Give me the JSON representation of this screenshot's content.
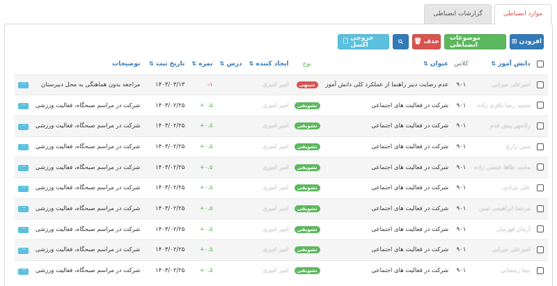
{
  "tabs": [
    {
      "label": "موارد انضباطی",
      "active": true
    },
    {
      "label": "گزارشات انضباطی",
      "active": false
    }
  ],
  "toolbar": {
    "add_label": "افزودن",
    "topics_label": "موضوعات انضباطی",
    "delete_label": "حذف",
    "excel_label": "خروجی اکسل"
  },
  "table": {
    "headers": {
      "student": "دانش آموز",
      "class": "کلاس",
      "title": "عنوان",
      "type": "نوع",
      "creator": "ایجاد کننده",
      "lesson": "درس",
      "grade": "نمره",
      "date": "تاریخ ثبت",
      "notes": "توضیحات"
    },
    "rows": [
      {
        "student": "امیرعلی میرابی",
        "class": "۹۰۱",
        "title": "عدم رضایت دبیر راهنما از عملکرد کلی دانش آموز",
        "type": "تنبیهی",
        "type_color": "#d9534f",
        "creator": "امیر امیری",
        "grade": "-۱",
        "grade_sign": "neg",
        "date": "۱۴۰۳/۰۳/۱۳",
        "notes": "مراجعه بدون هماهنگی به محل دبیرستان"
      },
      {
        "student": "محمد رضا باقری زاده",
        "class": "۹۰۱",
        "title": "شرکت در فعالیت های اجتماعی",
        "type": "تشویقی",
        "type_color": "#5cb85c",
        "creator": "امیر امیری",
        "grade": "+۰.۵",
        "grade_sign": "pos",
        "date": "۱۴۰۳/۰۲/۲۵",
        "notes": "شرکت در مراسم صبحگاه، فعالیت ورزشی"
      },
      {
        "student": "رادمهر پیش قدم",
        "class": "۹۰۱",
        "title": "شرکت در فعالیت های اجتماعی",
        "type": "تشویقی",
        "type_color": "#5cb85c",
        "creator": "امیر امیری",
        "grade": "+۰.۵",
        "grade_sign": "pos",
        "date": "۱۴۰۳/۰۲/۲۵",
        "notes": "شرکت در مراسم صبحگاه، فعالیت ورزشی"
      },
      {
        "student": "متین زارع",
        "class": "۹۰۱",
        "title": "شرکت در فعالیت های اجتماعی",
        "type": "تشویقی",
        "type_color": "#5cb85c",
        "creator": "امیر امیری",
        "grade": "+۰.۵",
        "grade_sign": "pos",
        "date": "۱۴۰۳/۰۲/۲۵",
        "notes": "شرکت در مراسم صبحگاه، فعالیت ورزشی"
      },
      {
        "student": "محمد طاها عیشی زاده",
        "class": "۹۰۱",
        "title": "شرکت در فعالیت های اجتماعی",
        "type": "تشویقی",
        "type_color": "#5cb85c",
        "creator": "امیر امیری",
        "grade": "+۰.۵",
        "grade_sign": "pos",
        "date": "۱۴۰۳/۰۲/۲۵",
        "notes": "شرکت در مراسم صبحگاه، فعالیت ورزشی"
      },
      {
        "student": "علی مرادی",
        "class": "۹۰۱",
        "title": "شرکت در فعالیت های اجتماعی",
        "type": "تشویقی",
        "type_color": "#5cb85c",
        "creator": "امیر امیری",
        "grade": "+۰.۵",
        "grade_sign": "pos",
        "date": "۱۴۰۳/۰۲/۲۵",
        "notes": "شرکت در مراسم صبحگاه، فعالیت ورزشی"
      },
      {
        "student": "مرتضا ابراهیمی ثمین",
        "class": "۹۰۱",
        "title": "شرکت در فعالیت های اجتماعی",
        "type": "تشویقی",
        "type_color": "#5cb85c",
        "creator": "امیر امیری",
        "grade": "+۰.۵",
        "grade_sign": "pos",
        "date": "۱۴۰۳/۰۲/۲۵",
        "notes": "شرکت در مراسم صبحگاه، فعالیت ورزشی"
      },
      {
        "student": "آرمان قهرمان",
        "class": "۹۰۱",
        "title": "شرکت در فعالیت های اجتماعی",
        "type": "تشویقی",
        "type_color": "#5cb85c",
        "creator": "امیر امیری",
        "grade": "+۰.۵",
        "grade_sign": "pos",
        "date": "۱۴۰۳/۰۲/۲۵",
        "notes": "شرکت در مراسم صبحگاه، فعالیت ورزشی"
      },
      {
        "student": "امیرعلی میرابی",
        "class": "۹۰۱",
        "title": "شرکت در فعالیت های اجتماعی",
        "type": "تشویقی",
        "type_color": "#5cb85c",
        "creator": "امیر امیری",
        "grade": "+۰.۵",
        "grade_sign": "pos",
        "date": "۱۴۰۳/۰۲/۲۵",
        "notes": "شرکت در مراسم صبحگاه، فعالیت ورزشی"
      },
      {
        "student": "نیما رمضانی",
        "class": "۹۰۱",
        "title": "شرکت در فعالیت های اجتماعی",
        "type": "تشویقی",
        "type_color": "#5cb85c",
        "creator": "امیر امیری",
        "grade": "+۰.۵",
        "grade_sign": "pos",
        "date": "۱۴۰۳/۰۲/۲۵",
        "notes": "شرکت در مراسم صبحگاه، فعالیت ورزشی"
      }
    ]
  },
  "icons": {
    "add": "plus-square-icon",
    "delete": "trash-icon",
    "search": "search-icon",
    "excel": "file-icon",
    "sort": "sort-icon",
    "more": "ellipsis-icon"
  }
}
